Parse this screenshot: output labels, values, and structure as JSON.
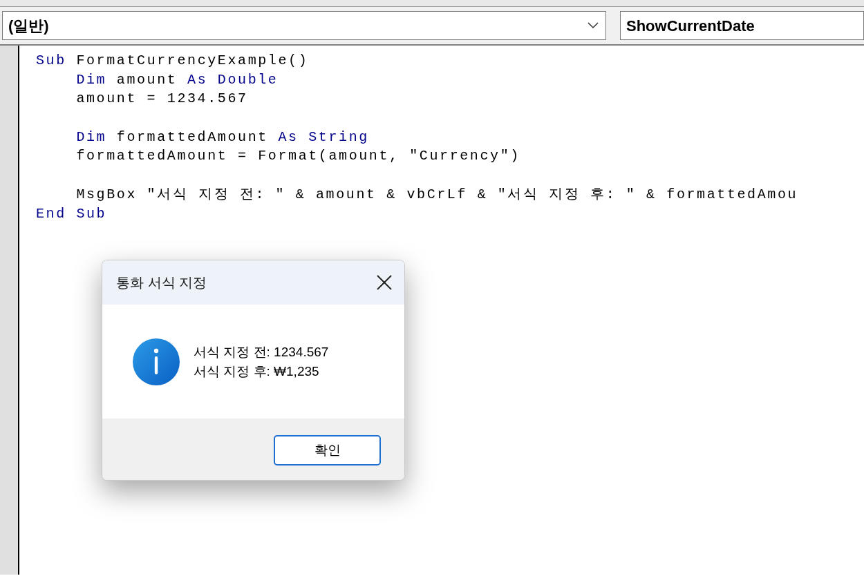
{
  "procedure_bar": {
    "object_combo": "(일반)",
    "procedure_combo": "ShowCurrentDate"
  },
  "code_lines": [
    {
      "kind": "code",
      "indented": false,
      "tokens": [
        {
          "kind": "keyword",
          "text": "Sub"
        },
        {
          "kind": "plain",
          "text": " FormatCurrencyExample()"
        }
      ]
    },
    {
      "kind": "code",
      "indented": true,
      "tokens": [
        {
          "kind": "keyword",
          "text": "Dim"
        },
        {
          "kind": "plain",
          "text": " amount "
        },
        {
          "kind": "keyword",
          "text": "As Double"
        }
      ]
    },
    {
      "kind": "code",
      "indented": true,
      "tokens": [
        {
          "kind": "plain",
          "text": "amount = 1234.567"
        }
      ]
    },
    {
      "kind": "blank"
    },
    {
      "kind": "code",
      "indented": true,
      "tokens": [
        {
          "kind": "keyword",
          "text": "Dim"
        },
        {
          "kind": "plain",
          "text": " formattedAmount "
        },
        {
          "kind": "keyword",
          "text": "As String"
        }
      ]
    },
    {
      "kind": "code",
      "indented": true,
      "tokens": [
        {
          "kind": "plain",
          "text": "formattedAmount = Format(amount, \"Currency\")"
        }
      ]
    },
    {
      "kind": "blank"
    },
    {
      "kind": "code",
      "indented": true,
      "tokens": [
        {
          "kind": "plain",
          "text": "MsgBox \"서식 지정 전: \" & amount & vbCrLf & \"서식 지정 후: \" & formattedAmou"
        }
      ]
    },
    {
      "kind": "code",
      "indented": false,
      "tokens": [
        {
          "kind": "keyword",
          "text": "End Sub"
        }
      ]
    }
  ],
  "message_box": {
    "title": "통화 서식 지정",
    "lines": [
      "서식 지정 전: 1234.567",
      "서식 지정 후: ₩1,235"
    ],
    "button": "확인"
  }
}
